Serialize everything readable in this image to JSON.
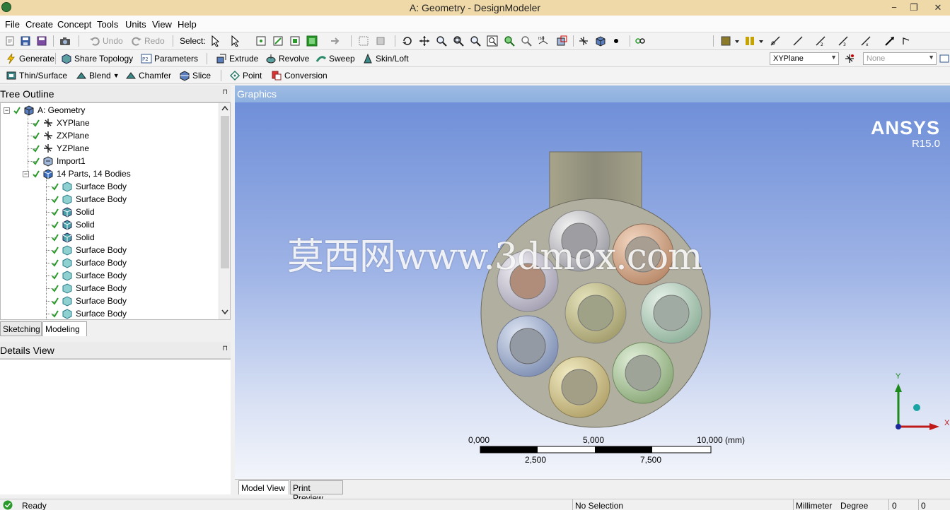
{
  "window": {
    "title": "A: Geometry - DesignModeler",
    "minimize": "−",
    "restore": "❐",
    "close": "✕"
  },
  "menu": [
    "File",
    "Create",
    "Concept",
    "Tools",
    "Units",
    "View",
    "Help"
  ],
  "toolbar1": {
    "undo": "Undo",
    "redo": "Redo",
    "select_label": "Select:"
  },
  "toolbar2": {
    "generate": "Generate",
    "share_topology": "Share Topology",
    "parameters": "Parameters",
    "extrude": "Extrude",
    "revolve": "Revolve",
    "sweep": "Sweep",
    "skin_loft": "Skin/Loft",
    "plane_select": "XYPlane",
    "sketch_select": "None"
  },
  "toolbar3": {
    "thin_surface": "Thin/Surface",
    "blend": "Blend",
    "blend_arrow": "▼",
    "chamfer": "Chamfer",
    "slice": "Slice",
    "point": "Point",
    "conversion": "Conversion"
  },
  "tree_outline": {
    "header": "Tree Outline",
    "pin": "⊓",
    "items": [
      {
        "label": "A: Geometry",
        "icon": "geometry-root-icon"
      },
      {
        "label": "XYPlane",
        "icon": "plane-axes-icon"
      },
      {
        "label": "ZXPlane",
        "icon": "plane-axes-icon"
      },
      {
        "label": "YZPlane",
        "icon": "plane-axes-icon"
      },
      {
        "label": "Import1",
        "icon": "import-icon"
      },
      {
        "label": "14 Parts, 14 Bodies",
        "icon": "parts-icon"
      },
      {
        "label": "Surface Body",
        "icon": "surface-body-icon"
      },
      {
        "label": "Surface Body",
        "icon": "surface-body-icon"
      },
      {
        "label": "Solid",
        "icon": "solid-body-icon"
      },
      {
        "label": "Solid",
        "icon": "solid-body-icon"
      },
      {
        "label": "Solid",
        "icon": "solid-body-icon"
      },
      {
        "label": "Surface Body",
        "icon": "surface-body-icon"
      },
      {
        "label": "Surface Body",
        "icon": "surface-body-icon"
      },
      {
        "label": "Surface Body",
        "icon": "surface-body-icon"
      },
      {
        "label": "Surface Body",
        "icon": "surface-body-icon"
      },
      {
        "label": "Surface Body",
        "icon": "surface-body-icon"
      },
      {
        "label": "Surface Body",
        "icon": "surface-body-icon"
      }
    ],
    "tabs": [
      "Sketching",
      "Modeling"
    ]
  },
  "details_view": {
    "header": "Details View",
    "pin": "⊓"
  },
  "graphics": {
    "header": "Graphics",
    "brand": "ANSYS",
    "version": "R15.0",
    "watermark": "莫西网www.3dmox.com",
    "scale_labels_top": [
      "0,000",
      "5,000",
      "10,000 (mm)"
    ],
    "scale_labels_bottom": [
      "2,500",
      "7,500"
    ],
    "axis_y": "Y",
    "axis_x": "X",
    "tabs": [
      "Model View",
      "Print Preview"
    ]
  },
  "status": {
    "state": "Ready",
    "selection": "No Selection",
    "length_unit": "Millimeter",
    "angle_unit": "Degree",
    "value1": "0",
    "value2": "0"
  },
  "colors": {
    "title_bar": "#f0d9a8",
    "graphics_top": "#6f8fd8",
    "graphics_bottom": "#f3f5fb",
    "check_green": "#2a9a2a"
  }
}
